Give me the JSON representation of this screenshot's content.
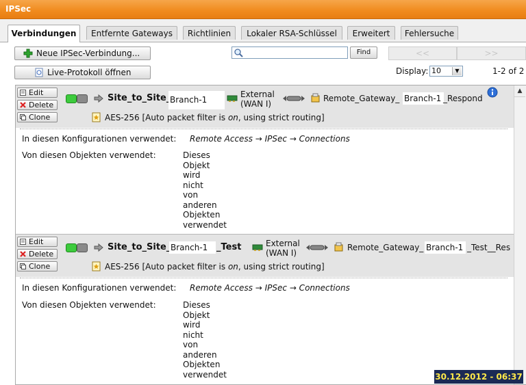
{
  "window": {
    "title": "IPSec"
  },
  "tabs": [
    {
      "label": "Verbindungen",
      "active": true
    },
    {
      "label": "Entfernte Gateways"
    },
    {
      "label": "Richtlinien"
    },
    {
      "label": "Lokaler RSA-Schlüssel"
    },
    {
      "label": "Erweitert"
    },
    {
      "label": "Fehlersuche"
    }
  ],
  "toolbar": {
    "new_connection_label": "Neue IPSec-Verbindung...",
    "live_log_label": "Live-Protokoll öffnen",
    "search_value": "",
    "find_label": "Find",
    "prev_label": "<<",
    "next_label": ">>",
    "display_label": "Display:",
    "display_value": "10",
    "count_label": "1-2 of 2"
  },
  "connections": [
    {
      "edit_label": "Edit",
      "delete_label": "Delete",
      "clone_label": "Clone",
      "name_prefix": "Site_to_Site_",
      "name_box": "Branch-1",
      "name_suffix": "",
      "interface_line1": "External",
      "interface_line2": "(WAN I)",
      "gateway_prefix": "Remote_Gateway_",
      "gateway_box": "Branch-1",
      "gateway_suffix": "_Respond",
      "policy_text": "AES-256  [Auto packet filter is ",
      "policy_on": "on",
      "policy_tail": ", using strict routing]",
      "used_in_label": "In diesen Konfigurationen verwendet:",
      "used_in_path": "Remote Access → IPSec → Connections",
      "used_by_label": "Von diesen Objekten verwendet:",
      "used_by_words": [
        "Dieses",
        "Objekt",
        "wird",
        "nicht",
        "von",
        "anderen",
        "Objekten",
        "verwendet"
      ]
    },
    {
      "edit_label": "Edit",
      "delete_label": "Delete",
      "clone_label": "Clone",
      "name_prefix": "Site_to_Site_",
      "name_box": "Branch-1",
      "name_suffix": "_Test",
      "interface_line1": "External",
      "interface_line2": "(WAN I)",
      "gateway_prefix": "Remote_Gateway_",
      "gateway_box": "Branch-1",
      "gateway_suffix": "_Test__Res",
      "policy_text": "AES-256  [Auto packet filter is ",
      "policy_on": "on",
      "policy_tail": ", using strict routing]",
      "used_in_label": "In diesen Konfigurationen verwendet:",
      "used_in_path": "Remote Access → IPSec → Connections",
      "used_by_label": "Von diesen Objekten verwendet:",
      "used_by_words": [
        "Dieses",
        "Objekt",
        "wird",
        "nicht",
        "von",
        "anderen",
        "Objekten",
        "verwendet"
      ]
    }
  ],
  "overlay": {
    "datetime": "30.12.2012 - 06:37"
  }
}
